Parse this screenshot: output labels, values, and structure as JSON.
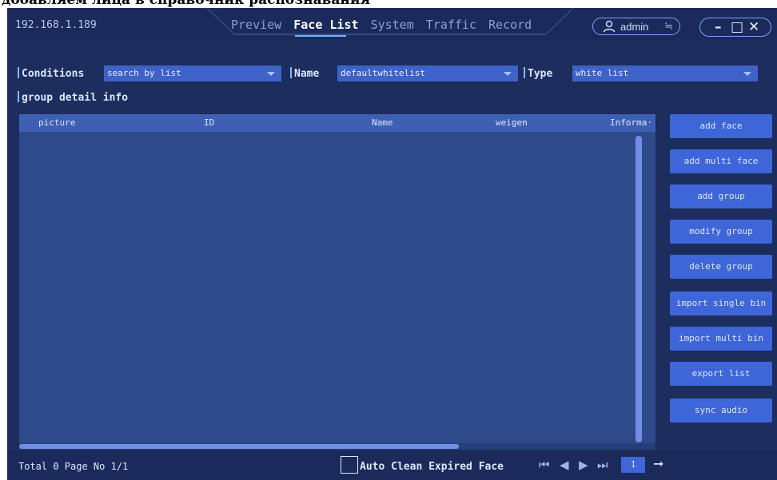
{
  "crop_text": "добавляем лица в справочник распознавания",
  "titlebar": {
    "ip": "192.168.1.189",
    "nav": [
      {
        "label": "Preview",
        "active": false
      },
      {
        "label": "Face List",
        "active": true
      },
      {
        "label": "System",
        "active": false
      },
      {
        "label": "Traffic",
        "active": false
      },
      {
        "label": "Record",
        "active": false
      }
    ],
    "user": "admin",
    "swap_icon": "≒",
    "win_min": "–",
    "win_max": "□",
    "win_close": "✕"
  },
  "conditions": {
    "conditions_label": "Conditions",
    "conditions_value": "search by list",
    "name_label": "Name",
    "name_value": "defaultwhitelist",
    "type_label": "Type",
    "type_value": "white list"
  },
  "group_label": "group detail info",
  "table": {
    "columns": [
      "picture",
      "ID",
      "Name",
      "weigen",
      "Informa·"
    ],
    "rows": []
  },
  "side_buttons": [
    "add face",
    "add multi face",
    "add group",
    "modify group",
    "delete group",
    "import single bin",
    "import multi bin",
    "export list",
    "sync audio"
  ],
  "footer": {
    "total": "Total 0  Page No 1/1",
    "auto_clean": "Auto Clean Expired Face",
    "page_value": "1",
    "first_icon": "⏮",
    "prev_icon": "◀",
    "next_icon": "▶",
    "last_icon": "⏭",
    "go_icon": "➞"
  },
  "colors": {
    "background": "#1c2d5e",
    "table": "#2f4a8a",
    "button": "#3f66d8",
    "accent": "#6fb3ff"
  }
}
